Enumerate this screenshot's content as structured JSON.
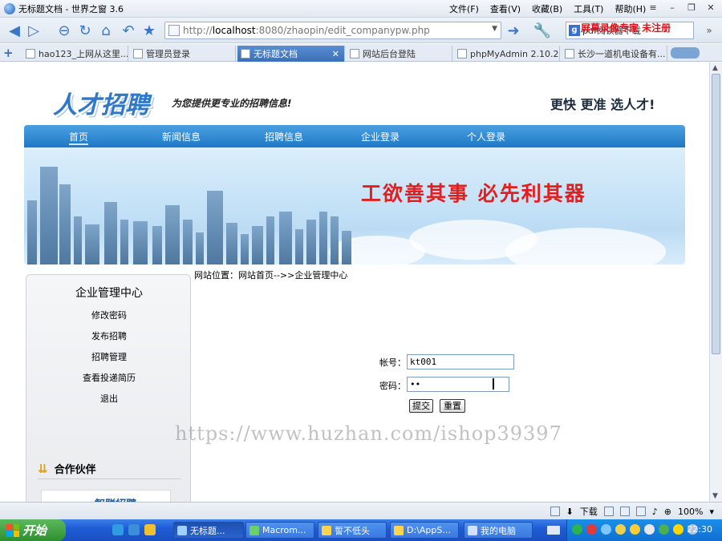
{
  "window": {
    "title": "无标题文档 - 世界之窗 3.6"
  },
  "menu": [
    {
      "label": "文件(F)"
    },
    {
      "label": "查看(V)"
    },
    {
      "label": "收藏(B)"
    },
    {
      "label": "工具(T)"
    },
    {
      "label": "帮助(H)"
    }
  ],
  "address": {
    "scheme": "http://",
    "host": "localhost",
    "path": ":8080/zhaopin/edit_companypw.php"
  },
  "search": {
    "text": "pdf阅读器下载"
  },
  "watermark_top": "屏幕录像专家 未注册",
  "tabs": [
    {
      "label": "hao123_上网从这里..."
    },
    {
      "label": "管理员登录"
    },
    {
      "label": "无标题文档"
    },
    {
      "label": "网站后台登陆"
    },
    {
      "label": "phpMyAdmin 2.10.2..."
    },
    {
      "label": "长沙一道机电设备有..."
    }
  ],
  "site": {
    "logo": "人才招聘",
    "slogan": "为您提供更专业的招聘信息!",
    "tagline": "更快 更准 选人才!",
    "nav": [
      {
        "label": "首页"
      },
      {
        "label": "新闻信息"
      },
      {
        "label": "招聘信息"
      },
      {
        "label": "企业登录"
      },
      {
        "label": "个人登录"
      }
    ],
    "banner_text": "工欲善其事  必先利其器"
  },
  "sidebar": {
    "title": "企业管理中心",
    "items": [
      {
        "label": "修改密码"
      },
      {
        "label": "发布招聘"
      },
      {
        "label": "招聘管理"
      },
      {
        "label": "查看投递简历"
      },
      {
        "label": "退出"
      }
    ],
    "partner_title": "合作伙伴",
    "partner_logo": "智联招聘"
  },
  "breadcrumb": "网站位置：网站首页-->>企业管理中心",
  "form": {
    "account_label": "帐号：",
    "account_value": "kt001",
    "password_label": "密码：",
    "password_value": "••",
    "submit": "提交",
    "reset": "重置"
  },
  "watermark_url": "https://www.huzhan.com/ishop39397",
  "statusbar": {
    "download": "下载",
    "zoom": "100%"
  },
  "taskbar": {
    "start": "开始",
    "tasks": [
      {
        "label": "无标题..."
      },
      {
        "label": "Macrom..."
      },
      {
        "label": "誓不低头"
      },
      {
        "label": "D:\\AppS..."
      },
      {
        "label": "我的电脑"
      }
    ],
    "clock": "22:30"
  },
  "colors": {
    "nav_blue": "#1f78c6",
    "banner_red": "#e21f1f",
    "taskbar_blue": "#1f5cd6",
    "tray_blue": "#0f6fd2"
  }
}
